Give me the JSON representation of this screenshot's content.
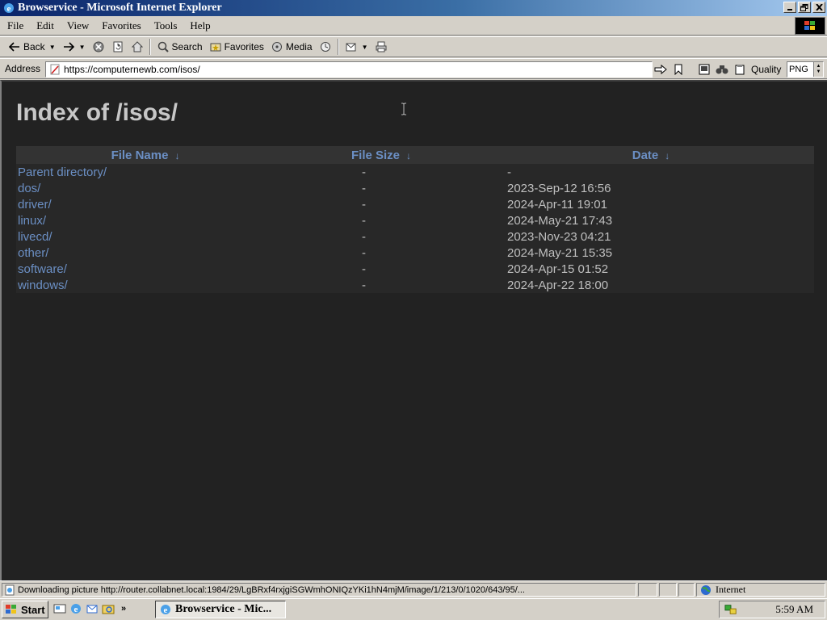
{
  "window": {
    "title": "Browservice - Microsoft Internet Explorer"
  },
  "menu": [
    "File",
    "Edit",
    "View",
    "Favorites",
    "Tools",
    "Help"
  ],
  "toolbar": {
    "back_label": "Back",
    "search_label": "Search",
    "favorites_label": "Favorites",
    "media_label": "Media"
  },
  "address": {
    "label": "Address",
    "url": "https://computernewb.com/isos/",
    "quality_label": "Quality",
    "quality_value": "PNG"
  },
  "page": {
    "title": "Index of /isos/",
    "columns": [
      {
        "label": "File Name",
        "sort_arrow": "↓"
      },
      {
        "label": "File Size",
        "sort_arrow": "↓"
      },
      {
        "label": "Date",
        "sort_arrow": "↓"
      }
    ],
    "rows": [
      {
        "name": "Parent directory/",
        "size": "-",
        "date": "-"
      },
      {
        "name": "dos/",
        "size": "-",
        "date": "2023-Sep-12 16:56"
      },
      {
        "name": "driver/",
        "size": "-",
        "date": "2024-Apr-11 19:01"
      },
      {
        "name": "linux/",
        "size": "-",
        "date": "2024-May-21 17:43"
      },
      {
        "name": "livecd/",
        "size": "-",
        "date": "2023-Nov-23 04:21"
      },
      {
        "name": "other/",
        "size": "-",
        "date": "2024-May-21 15:35"
      },
      {
        "name": "software/",
        "size": "-",
        "date": "2024-Apr-15 01:52"
      },
      {
        "name": "windows/",
        "size": "-",
        "date": "2024-Apr-22 18:00"
      }
    ]
  },
  "status": {
    "text": "Downloading picture http://router.collabnet.local:1984/29/LgBRxf4rxjgiSGWmhONIQzYKi1hN4mjM/image/1/213/0/1020/643/95/...",
    "zone": "Internet"
  },
  "taskbar": {
    "start_label": "Start",
    "task_label": "Browservice - Mic...",
    "clock": "5:59 AM",
    "chevron": "»"
  },
  "colors": {
    "content_bg": "#222222",
    "link": "#6b8fc4",
    "title_text": "#c7c7c7"
  }
}
